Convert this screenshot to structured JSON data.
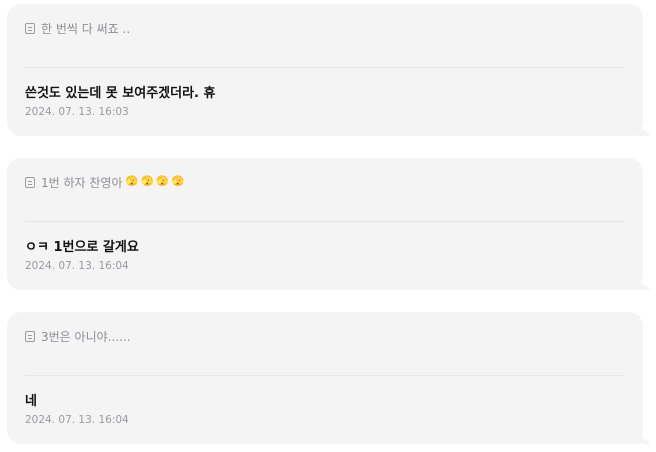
{
  "messages": [
    {
      "question": "한 번씩 다 써죠 ..",
      "question_icon": "memo-icon",
      "answer": "쓴것도 있는데 못 보여주겠더라. 휴",
      "timestamp": "2024. 07. 13. 16:03"
    },
    {
      "question": "1번 하자 찬영아",
      "question_icon": "memo-icon",
      "question_emojis": [
        "🫣",
        "🫣",
        "🫣",
        "🫣"
      ],
      "answer": "ㅇㅋ 1번으로 갈게요",
      "timestamp": "2024. 07. 13. 16:04"
    },
    {
      "question": "3번은 아니야......",
      "question_icon": "memo-icon",
      "answer": "네",
      "timestamp": "2024. 07. 13. 16:04"
    }
  ],
  "colors": {
    "card_background": "#f4f4f5",
    "question_text": "#8e8e93",
    "answer_text": "#111111",
    "timestamp_text": "#9a9a9f"
  }
}
